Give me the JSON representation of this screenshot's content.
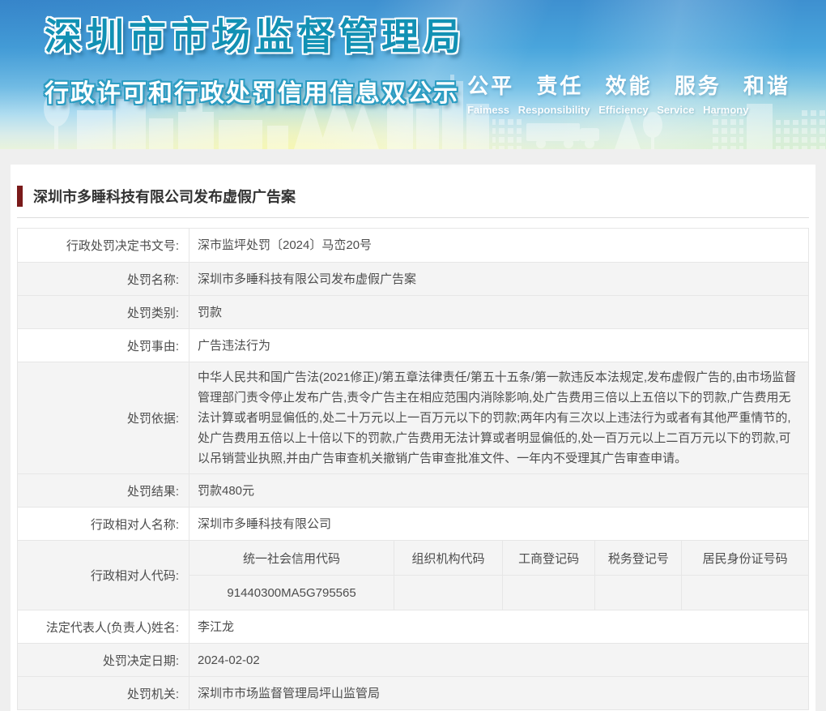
{
  "banner": {
    "title": "深圳市市场监督管理局",
    "subtitle": "行政许可和行政处罚信用信息双公示",
    "slogan_cn": "公平 责任 效能 服务 和谐",
    "slogan_en": "Faimess Responsibility Efficiency Service Harmony"
  },
  "case": {
    "title": "深圳市多睡科技有限公司发布虚假广告案"
  },
  "rows": [
    {
      "label": "行政处罚决定书文号:",
      "value": "深市监坪处罚〔2024〕马峦20号"
    },
    {
      "label": "处罚名称:",
      "value": "深圳市多睡科技有限公司发布虚假广告案"
    },
    {
      "label": "处罚类别:",
      "value": "罚款"
    },
    {
      "label": "处罚事由:",
      "value": "广告违法行为"
    },
    {
      "label": "处罚依据:",
      "value": "中华人民共和国广告法(2021修正)/第五章法律责任/第五十五条/第一款违反本法规定,发布虚假广告的,由市场监督管理部门责令停止发布广告,责令广告主在相应范围内消除影响,处广告费用三倍以上五倍以下的罚款,广告费用无法计算或者明显偏低的,处二十万元以上一百万元以下的罚款;两年内有三次以上违法行为或者有其他严重情节的,处广告费用五倍以上十倍以下的罚款,广告费用无法计算或者明显偏低的,处一百万元以上二百万元以下的罚款,可以吊销营业执照,并由广告审查机关撤销广告审查批准文件、一年内不受理其广告审查申请。"
    },
    {
      "label": "处罚结果:",
      "value": "罚款480元"
    },
    {
      "label": "行政相对人名称:",
      "value": "深圳市多睡科技有限公司"
    }
  ],
  "code_row": {
    "label": "行政相对人代码:",
    "columns": [
      "统一社会信用代码",
      "组织机构代码",
      "工商登记码",
      "税务登记号",
      "居民身份证号码"
    ],
    "values": [
      "91440300MA5G795565",
      "",
      "",
      "",
      ""
    ]
  },
  "rows_tail": [
    {
      "label": "法定代表人(负责人)姓名:",
      "value": "李江龙"
    },
    {
      "label": "处罚决定日期:",
      "value": "2024-02-02"
    },
    {
      "label": "处罚机关:",
      "value": "深圳市市场监督管理局坪山监管局"
    }
  ],
  "colors": {
    "accent_bar": "#7a1a1a",
    "banner_title": "#1291b4",
    "row_shade": "#f4f4f4",
    "page_background": "#efefef"
  }
}
